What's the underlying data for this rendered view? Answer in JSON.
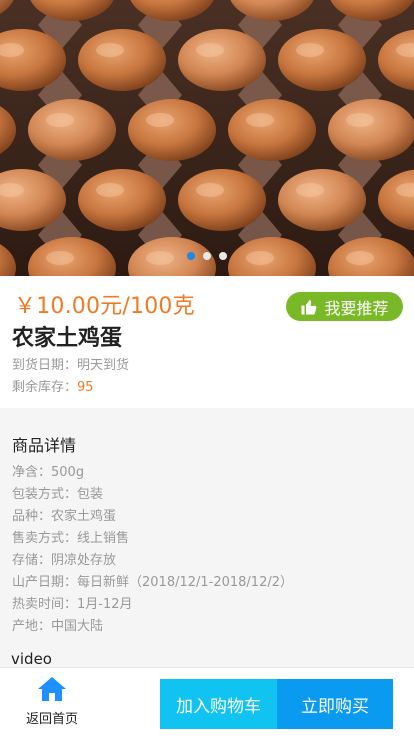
{
  "banner": {
    "image": "egg-carton-photo",
    "slides": 3,
    "active_slide": 1
  },
  "product": {
    "price": "￥10.00元/100克",
    "name": "农家土鸡蛋",
    "recommend_label": "我要推荐",
    "recommend_icon": "thumbs-up-icon",
    "arrival_label": "到货日期：",
    "arrival_value": "明天到货",
    "stock_label": "剩余库存：",
    "stock_value": "95"
  },
  "details": {
    "title": "商品详情",
    "specs": [
      "净含：500g",
      "包装方式：包装",
      "品种：农家土鸡蛋",
      "售卖方式：线上销售",
      "存储：阴凉处存放",
      "山产日期：每日新鲜（2018/12/1-2018/12/2）",
      "热卖时间：1月-12月",
      "产地：中国大陆"
    ],
    "video_label": "video"
  },
  "bottom_bar": {
    "home_label": "返回首页",
    "home_icon": "home-icon",
    "cart_label": "加入购物车",
    "buy_label": "立即购买"
  },
  "colors": {
    "price": "#f07b24",
    "recommend_bg": "#79b928",
    "cart_bg": "#11c3f0",
    "buy_bg": "#0a9af0",
    "home_icon": "#1e90ff",
    "active_dot": "#1e88e5"
  }
}
